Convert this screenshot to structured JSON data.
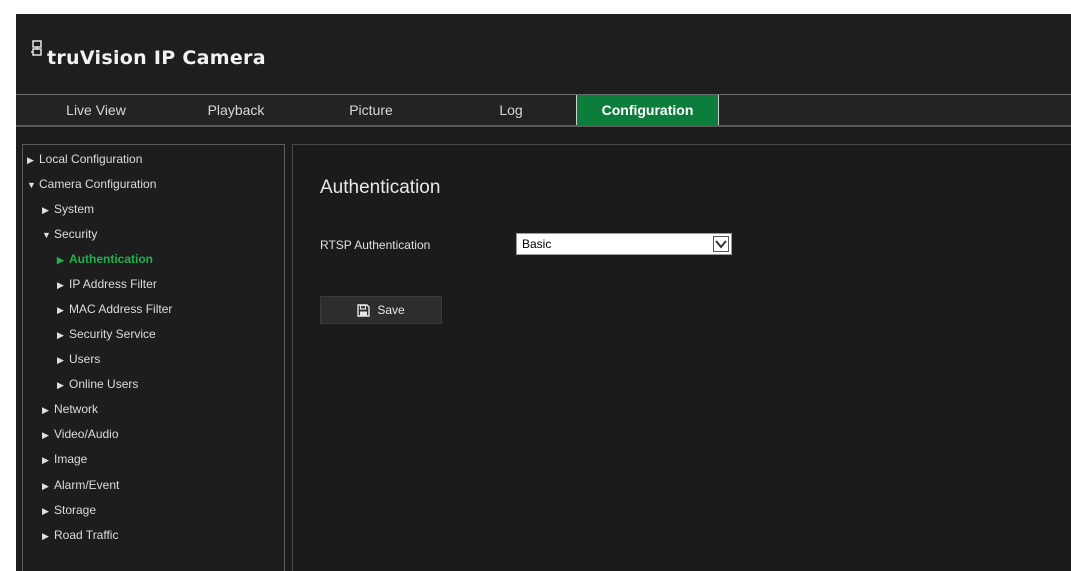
{
  "app": {
    "brand": "truVision IP Camera"
  },
  "nav": {
    "tabs": [
      {
        "label": "Live View"
      },
      {
        "label": "Playback"
      },
      {
        "label": "Picture"
      },
      {
        "label": "Log"
      },
      {
        "label": "Configuration",
        "active": true
      }
    ]
  },
  "sidebar": {
    "items": [
      {
        "label": "Local Configuration"
      },
      {
        "label": "Camera Configuration"
      },
      {
        "label": "System"
      },
      {
        "label": "Security"
      },
      {
        "label": "Authentication",
        "selected": true
      },
      {
        "label": "IP Address Filter"
      },
      {
        "label": "MAC Address Filter"
      },
      {
        "label": "Security Service"
      },
      {
        "label": "Users"
      },
      {
        "label": "Online Users"
      },
      {
        "label": "Network"
      },
      {
        "label": "Video/Audio"
      },
      {
        "label": "Image"
      },
      {
        "label": "Alarm/Event"
      },
      {
        "label": "Storage"
      },
      {
        "label": "Road Traffic"
      }
    ]
  },
  "main": {
    "title": "Authentication",
    "rtsp_label": "RTSP Authentication",
    "rtsp_value": "Basic",
    "save_label": "Save"
  },
  "colors": {
    "accent": "#0d7d3b",
    "selected_text": "#22b04b",
    "background": "#1c1c1c"
  }
}
